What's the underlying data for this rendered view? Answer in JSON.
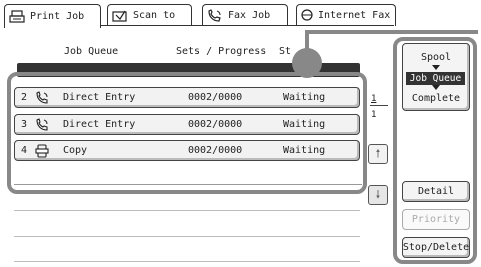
{
  "tabs": [
    {
      "label": "Print Job",
      "icon": "print-icon",
      "active": true
    },
    {
      "label": "Scan to",
      "icon": "scan-icon",
      "active": false
    },
    {
      "label": "Fax Job",
      "icon": "fax-icon",
      "active": false
    },
    {
      "label": "Internet Fax",
      "icon": "internet-fax-icon",
      "active": false
    }
  ],
  "columns": {
    "job_queue": "Job Queue",
    "sets_progress": "Sets / Progress",
    "status": "St"
  },
  "jobs": [
    {
      "num": "2",
      "icon": "direct-entry-icon",
      "name": "Direct Entry",
      "sets": "0002/0000",
      "status": "Waiting"
    },
    {
      "num": "3",
      "icon": "direct-entry-icon",
      "name": "Direct Entry",
      "sets": "0002/0000",
      "status": "Waiting"
    },
    {
      "num": "4",
      "icon": "copy-icon",
      "name": "Copy",
      "sets": "0002/0000",
      "status": "Waiting"
    }
  ],
  "pagination": {
    "current": "1",
    "total": "1"
  },
  "mode": {
    "spool": "Spool",
    "job_queue": "Job Queue",
    "complete": "Complete"
  },
  "buttons": {
    "detail": "Detail",
    "priority": "Priority",
    "stop_delete": "Stop/Delete"
  },
  "colors": {
    "highlight_frame": "#888888",
    "selected_mode": "#333333"
  }
}
